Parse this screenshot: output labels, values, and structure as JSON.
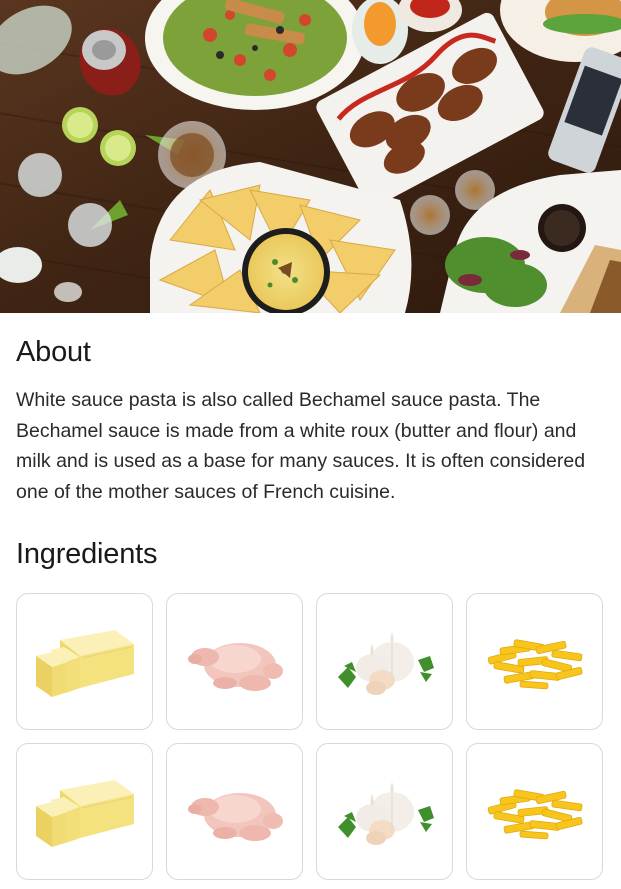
{
  "hero": {
    "icon": "food-spread-photo"
  },
  "about": {
    "title": "About",
    "text": "White sauce pasta is also called Bechamel sauce pasta. The Bechamel sauce is made from a white roux (butter and flour) and milk and is used as a base for many sauces. It is often considered one of the mother sauces of French cuisine."
  },
  "ingredients": {
    "title": "Ingredients",
    "items": [
      {
        "icon": "butter-icon"
      },
      {
        "icon": "raw-chicken-icon"
      },
      {
        "icon": "garlic-icon"
      },
      {
        "icon": "penne-pasta-icon"
      },
      {
        "icon": "butter-icon"
      },
      {
        "icon": "raw-chicken-icon"
      },
      {
        "icon": "garlic-icon"
      },
      {
        "icon": "penne-pasta-icon"
      }
    ]
  },
  "colors": {
    "table_wood": "#4a2c17",
    "butter": "#f6e79a",
    "chicken": "#f2c6bd",
    "garlic": "#f1ede6",
    "parsley": "#3f8f2c",
    "pasta": "#f7c51b",
    "card_border": "#d9d9d9"
  }
}
